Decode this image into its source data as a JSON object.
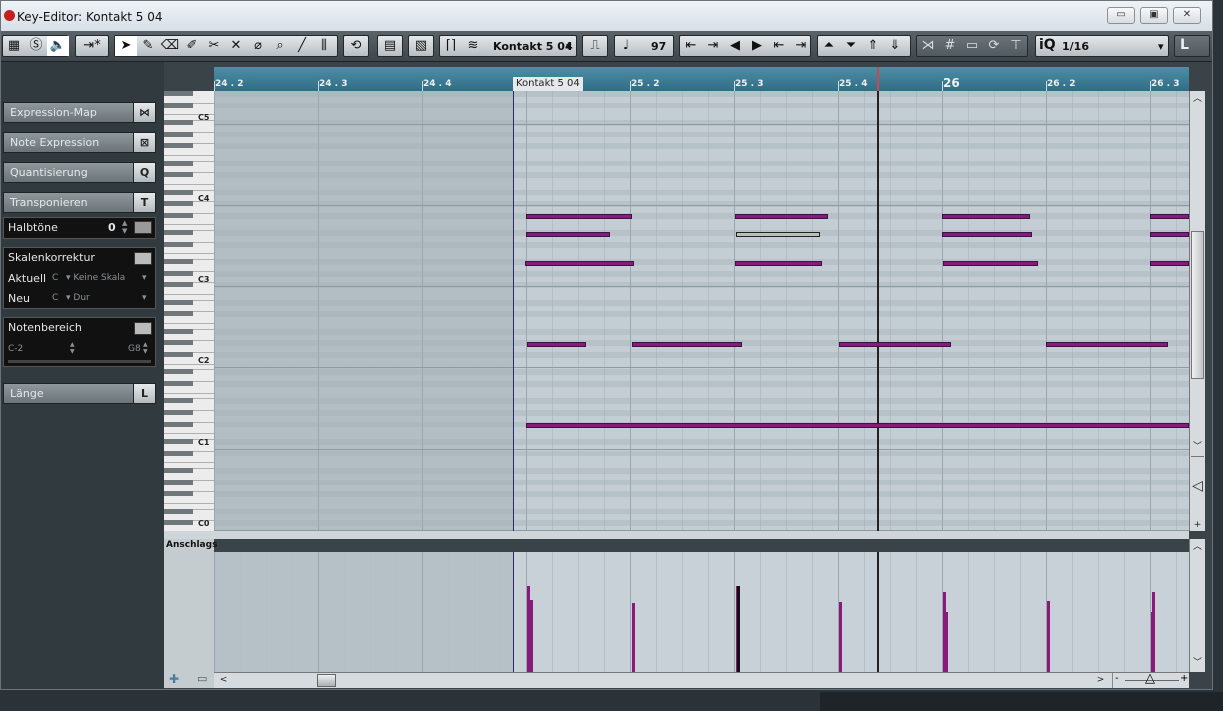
{
  "window": {
    "title": "Key-Editor: Kontakt 5 04",
    "minimize": "▭",
    "maximize": "▣",
    "close": "✕"
  },
  "toolbar": {
    "track_name": "Kontakt 5 04",
    "velocity": "97",
    "quantize_value": "1/16",
    "quantize_label": "iQ",
    "length_label": "L"
  },
  "inspector": {
    "expression_map": {
      "label": "Expression-Map",
      "key": "⋈"
    },
    "note_expression": {
      "label": "Note Expression",
      "key": "⊠"
    },
    "quantisierung": {
      "label": "Quantisierung",
      "key": "Q"
    },
    "transponieren": {
      "label": "Transponieren",
      "key": "T"
    },
    "halbtoene": {
      "label": "Halbtöne",
      "value": "0"
    },
    "skalenkorrektur": {
      "label": "Skalenkorrektur",
      "aktuell_label": "Aktuell",
      "aktuell_root": "C",
      "aktuell_scale": "Keine Skala",
      "neu_label": "Neu",
      "neu_root": "C",
      "neu_scale": "Dur"
    },
    "notenbereich": {
      "label": "Notenbereich",
      "low": "C-2",
      "high": "G8"
    },
    "laenge": {
      "label": "Länge",
      "key": "L"
    }
  },
  "keyboard": {
    "labels": [
      "C5",
      "C4",
      "C3",
      "C2",
      "C1",
      "C0"
    ]
  },
  "ruler": {
    "labels": [
      "24 . 2",
      "24 . 3",
      "24 . 4",
      "25 . 2",
      "25 . 3",
      "25 . 4",
      "26",
      "26 . 2",
      "26 . 3"
    ],
    "part_label": "Kontakt 5 04"
  },
  "velocity_lane": {
    "label": "Anschlags"
  },
  "colors": {
    "note": "#8a1a7a",
    "note_selected": "#b8c0b8",
    "ruler": "#3c7e98"
  }
}
